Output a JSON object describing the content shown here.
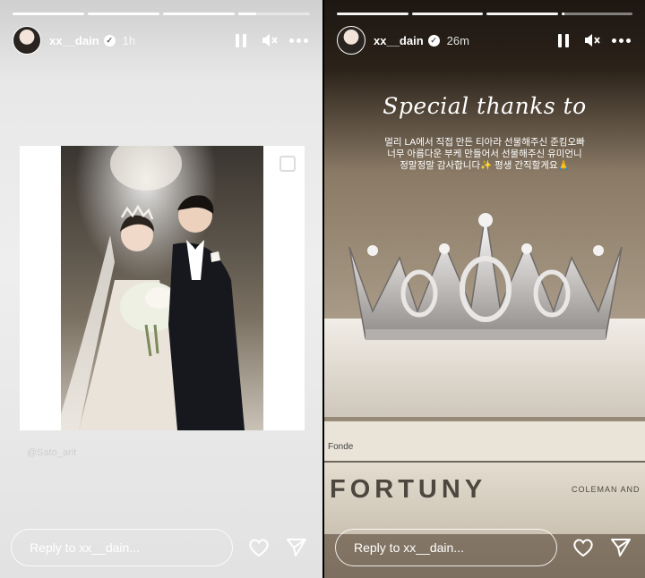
{
  "stories": [
    {
      "username": "xx__dain",
      "time_ago": "1h",
      "progress": [
        1,
        1,
        1,
        0.25
      ],
      "credit": "@Sato_arit",
      "reply_placeholder": "Reply to xx__dain..."
    },
    {
      "username": "xx__dain",
      "time_ago": "26m",
      "progress": [
        1,
        1,
        1,
        0.05
      ],
      "title": "Special thanks to",
      "message_line1": "멀리 LA에서 직접 만든 티아라 선물해주신 준킴오빠",
      "message_line2": "너무 아름다운 부케 만들어서 선물해주신 유미언니",
      "message_line3": "정말정말 감사합니다✨ 평생 간직할게요🙏",
      "book_spine": "Fonde",
      "book_title": "FORTUNY",
      "book_author": "COLEMAN AND",
      "reply_placeholder": "Reply to xx__dain..."
    }
  ],
  "icons": {
    "verified": "verified-badge-icon",
    "pause": "pause-icon",
    "mute": "mute-icon",
    "more": "more-icon",
    "like": "heart-icon",
    "share": "send-icon"
  }
}
